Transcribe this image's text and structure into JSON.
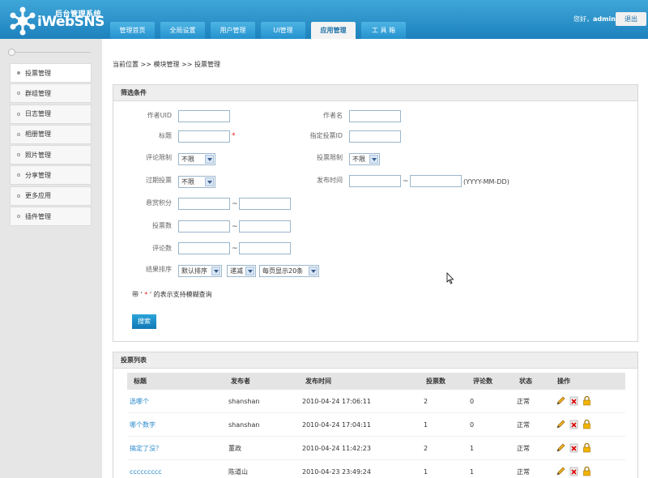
{
  "header": {
    "brand_sub": "后台管理系统",
    "brand": "iWebSNS",
    "greeting_prefix": "您好，",
    "user": "admin",
    "logout": "退出"
  },
  "nav": [
    "管理首页",
    "全局设置",
    "用户管理",
    "UI管理",
    "应用管理",
    "工 具 箱"
  ],
  "sidebar": [
    "投票管理",
    "群组管理",
    "日志管理",
    "相册管理",
    "照片管理",
    "分享管理",
    "更多应用",
    "插件管理"
  ],
  "breadcrumb": "当前位置 >> 模块管理 >> 投票管理",
  "filter": {
    "title": "筛选条件",
    "author_uid": "作者UID",
    "author_name": "作者名",
    "title_label": "标题",
    "star": "*",
    "vote_id": "指定投票ID",
    "comment_limit": "评论限制",
    "comment_limit_value": "不限",
    "vote_limit": "投票限制",
    "vote_limit_value": "不限",
    "expired": "过期投票",
    "expired_value": "不限",
    "publish_time": "发布时间",
    "date_hint": "(YYYY-MM-DD)",
    "reward": "悬赏积分",
    "votes": "投票数",
    "comments": "评论数",
    "sort": "结果排序",
    "sort_value": "默认排序",
    "order_value": "递减",
    "perpage_value": "每页显示20条",
    "tilde": "~",
    "note_a": "带 '",
    "note_star": " * ",
    "note_b": "' 的表示支持模糊查询",
    "search_btn": "搜索"
  },
  "list": {
    "title": "投票列表",
    "columns": [
      "标题",
      "发布者",
      "发布时间",
      "投票数",
      "评论数",
      "状态",
      "操作"
    ],
    "rows": [
      {
        "title": "选哪个",
        "author": "shanshan",
        "time": "2010-04-24 17:06:11",
        "votes": "2",
        "comments": "0",
        "status": "正常"
      },
      {
        "title": "哪个数字",
        "author": "shanshan",
        "time": "2010-04-24 17:04:11",
        "votes": "1",
        "comments": "0",
        "status": "正常"
      },
      {
        "title": "搞定了没？",
        "author": "董政",
        "time": "2010-04-24 11:42:23",
        "votes": "2",
        "comments": "1",
        "status": "正常"
      },
      {
        "title": "ccccccccc",
        "author": "陈道山",
        "time": "2010-04-23 23:49:24",
        "votes": "1",
        "comments": "1",
        "status": "正常"
      }
    ]
  },
  "colors": {
    "header": "#2a90c8",
    "accent": "#1d82bd",
    "link": "#2a8acb"
  }
}
